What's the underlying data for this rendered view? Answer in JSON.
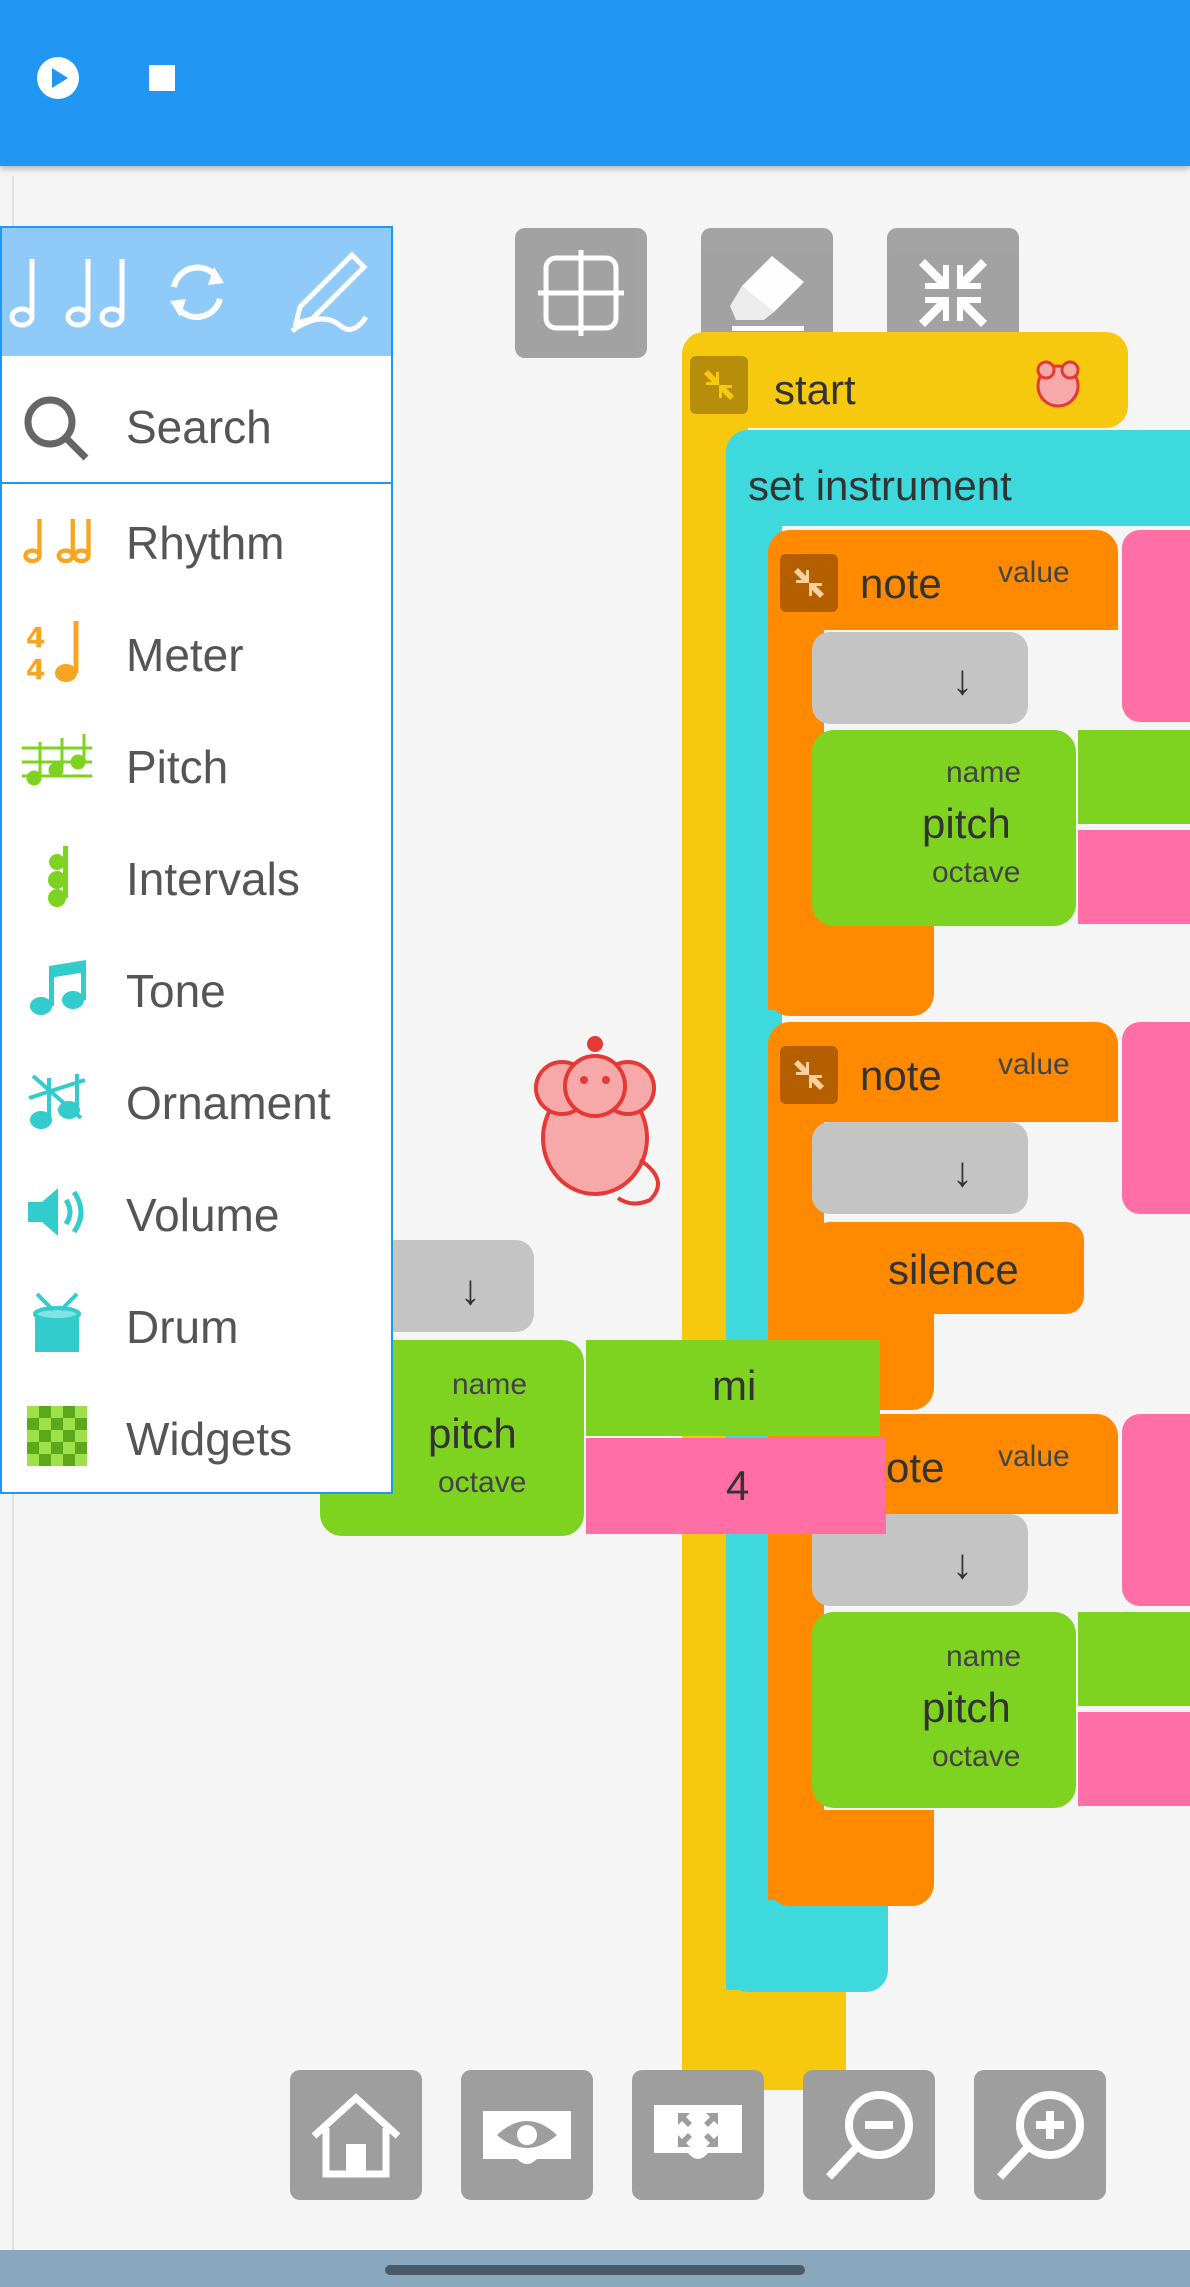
{
  "toolbar": {
    "play_icon": "play-icon",
    "stop_icon": "stop-icon",
    "color": "#2196f3"
  },
  "canvas_tools": [
    "grid-icon",
    "eraser-icon",
    "collapse-icon"
  ],
  "blocks": {
    "start": "start",
    "set_instrument": "set instrument",
    "note": "note",
    "note_partial": "ote",
    "value": "value",
    "arrow": "↓",
    "name": "name",
    "pitch": "pitch",
    "octave": "octave",
    "silence": "silence",
    "mi": "mi",
    "four": "4"
  },
  "palette": {
    "search": "Search",
    "items": [
      {
        "label": "Rhythm",
        "icon": "rhythm-icon",
        "color": "#f5a623"
      },
      {
        "label": "Meter",
        "icon": "meter-icon",
        "color": "#f5a623"
      },
      {
        "label": "Pitch",
        "icon": "pitch-icon",
        "color": "#7ed321"
      },
      {
        "label": "Intervals",
        "icon": "intervals-icon",
        "color": "#7ed321"
      },
      {
        "label": "Tone",
        "icon": "tone-icon",
        "color": "#3cc"
      },
      {
        "label": "Ornament",
        "icon": "ornament-icon",
        "color": "#3cc"
      },
      {
        "label": "Volume",
        "icon": "volume-icon",
        "color": "#3cc"
      },
      {
        "label": "Drum",
        "icon": "drum-icon",
        "color": "#3cc"
      },
      {
        "label": "Widgets",
        "icon": "widgets-icon",
        "color": "#7ed321"
      }
    ]
  },
  "bottom_buttons": [
    "home-icon",
    "eye-icon",
    "expand-icon",
    "zoom-out-icon",
    "zoom-in-icon"
  ]
}
